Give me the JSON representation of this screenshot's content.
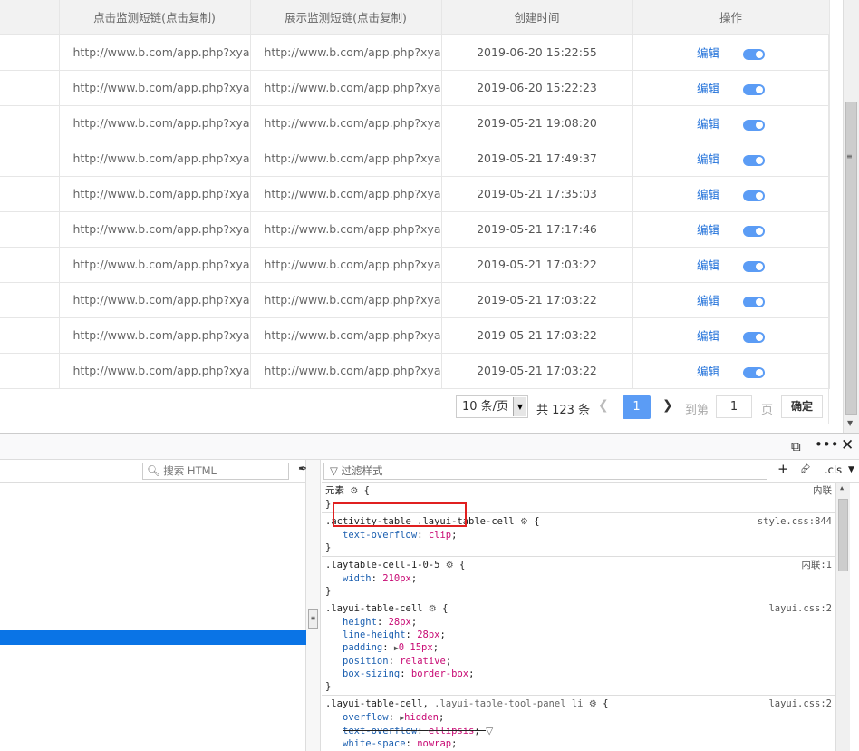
{
  "table": {
    "headers": [
      "点击监测短链(点击复制)",
      "展示监测短链(点击复制)",
      "创建时间",
      "操作"
    ],
    "rows": [
      {
        "click_url": "http://www.b.com/app.php?xyad=",
        "show_url": "http://www.b.com/app.php?xyad=",
        "time": "2019-06-20 15:22:55",
        "edit": "编辑"
      },
      {
        "click_url": "http://www.b.com/app.php?xyad=",
        "show_url": "http://www.b.com/app.php?xyad=",
        "time": "2019-06-20 15:22:23",
        "edit": "编辑"
      },
      {
        "click_url": "http://www.b.com/app.php?xyad=",
        "show_url": "http://www.b.com/app.php?xyad=",
        "time": "2019-05-21 19:08:20",
        "edit": "编辑"
      },
      {
        "click_url": "http://www.b.com/app.php?xyad=",
        "show_url": "http://www.b.com/app.php?xyad=",
        "time": "2019-05-21 17:49:37",
        "edit": "编辑"
      },
      {
        "click_url": "http://www.b.com/app.php?xyad=",
        "show_url": "http://www.b.com/app.php?xyad=",
        "time": "2019-05-21 17:35:03",
        "edit": "编辑"
      },
      {
        "click_url": "http://www.b.com/app.php?xyad=",
        "show_url": "http://www.b.com/app.php?xyad=",
        "time": "2019-05-21 17:17:46",
        "edit": "编辑"
      },
      {
        "click_url": "http://www.b.com/app.php?xyad=",
        "show_url": "http://www.b.com/app.php?xyad=",
        "time": "2019-05-21 17:03:22",
        "edit": "编辑"
      },
      {
        "click_url": "http://www.b.com/app.php?xyad=",
        "show_url": "http://www.b.com/app.php?xyad=",
        "time": "2019-05-21 17:03:22",
        "edit": "编辑"
      },
      {
        "click_url": "http://www.b.com/app.php?xyad=",
        "show_url": "http://www.b.com/app.php?xyad=",
        "time": "2019-05-21 17:03:22",
        "edit": "编辑"
      },
      {
        "click_url": "http://www.b.com/app.php?xyad=",
        "show_url": "http://www.b.com/app.php?xyad=",
        "time": "2019-05-21 17:03:22",
        "edit": "编辑"
      }
    ]
  },
  "pager": {
    "page_size": "10 条/页",
    "total": "共 123 条",
    "current": "1",
    "goto_label": "到第",
    "goto_value": "1",
    "page_label": "页",
    "confirm": "确定"
  },
  "devtools": {
    "search_html_placeholder": "搜索 HTML",
    "filter_placeholder": "过滤样式",
    "cls_label": ".cls",
    "rules": {
      "element": {
        "selector": "元素",
        "source": "内联",
        "close": "}"
      },
      "activity": {
        "selector": ".activity-table .layui-table-cell",
        "source": "style.css:844",
        "prop": "text-overflow",
        "value": "clip"
      },
      "laytable": {
        "selector": ".laytable-cell-1-0-5",
        "source": "内联:1",
        "prop": "width",
        "value": "210px"
      },
      "cell": {
        "selector": ".layui-table-cell",
        "source": "layui.css:2",
        "decls": [
          {
            "prop": "height",
            "value": "28px"
          },
          {
            "prop": "line-height",
            "value": "28px"
          },
          {
            "prop": "padding",
            "value": "0 15px"
          },
          {
            "prop": "position",
            "value": "relative"
          },
          {
            "prop": "box-sizing",
            "value": "border-box"
          }
        ]
      },
      "cell_panel": {
        "selector": ".layui-table-cell,",
        "selector2": ".layui-table-tool-panel li",
        "source": "layui.css:2",
        "decls": [
          {
            "prop": "overflow",
            "value": "hidden"
          },
          {
            "prop": "text-overflow",
            "value": "ellipsis"
          },
          {
            "prop": "white-space",
            "value": "nowrap"
          }
        ]
      }
    }
  },
  "colors": {
    "accent": "#5b9cf5",
    "link": "#1e6fd9",
    "selected": "#0a74e6",
    "highlight_border": "#e02020"
  }
}
